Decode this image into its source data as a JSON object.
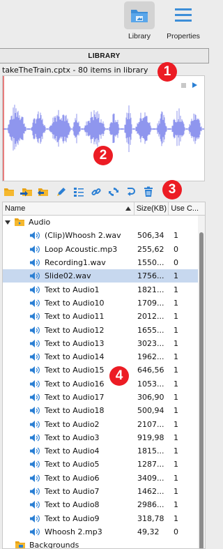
{
  "toolbar": {
    "library_label": "Library",
    "properties_label": "Properties"
  },
  "library": {
    "header": "LIBRARY",
    "info": "takeTheTrain.cptx - 80 items in library"
  },
  "preview": {
    "stop_icon": "stop-icon",
    "play_icon": "play-icon"
  },
  "icon_toolbar": [
    {
      "name": "new-folder-icon"
    },
    {
      "name": "import-icon"
    },
    {
      "name": "open-folder-icon"
    },
    {
      "name": "edit-icon"
    },
    {
      "name": "properties-list-icon"
    },
    {
      "name": "link-icon"
    },
    {
      "name": "update-icon"
    },
    {
      "name": "usage-icon"
    },
    {
      "name": "delete-icon"
    }
  ],
  "table": {
    "columns": [
      "Name",
      "Size(KB)",
      "Use C..."
    ],
    "rows": [
      {
        "type": "folder",
        "level": 0,
        "name": "Audio",
        "expanded": true
      },
      {
        "type": "audio",
        "level": 2,
        "name": "(Clip)Whoosh 2.wav",
        "size": "506,34",
        "use": "1"
      },
      {
        "type": "audio",
        "level": 2,
        "name": "Loop Acoustic.mp3",
        "size": "255,62",
        "use": "0"
      },
      {
        "type": "audio",
        "level": 2,
        "name": "Recording1.wav",
        "size": "1550...",
        "use": "0"
      },
      {
        "type": "audio",
        "level": 2,
        "name": "Slide02.wav",
        "size": "1756...",
        "use": "1",
        "selected": true
      },
      {
        "type": "audio",
        "level": 2,
        "name": "Text to Audio1",
        "size": "1821...",
        "use": "1"
      },
      {
        "type": "audio",
        "level": 2,
        "name": "Text to Audio10",
        "size": "1709...",
        "use": "1"
      },
      {
        "type": "audio",
        "level": 2,
        "name": "Text to Audio11",
        "size": "2012...",
        "use": "1"
      },
      {
        "type": "audio",
        "level": 2,
        "name": "Text to Audio12",
        "size": "1655...",
        "use": "1"
      },
      {
        "type": "audio",
        "level": 2,
        "name": "Text to Audio13",
        "size": "3023...",
        "use": "1"
      },
      {
        "type": "audio",
        "level": 2,
        "name": "Text to Audio14",
        "size": "1962...",
        "use": "1"
      },
      {
        "type": "audio",
        "level": 2,
        "name": "Text to Audio15",
        "size": "646,56",
        "use": "1"
      },
      {
        "type": "audio",
        "level": 2,
        "name": "Text to Audio16",
        "size": "1053...",
        "use": "1"
      },
      {
        "type": "audio",
        "level": 2,
        "name": "Text to Audio17",
        "size": "306,90",
        "use": "1"
      },
      {
        "type": "audio",
        "level": 2,
        "name": "Text to Audio18",
        "size": "500,94",
        "use": "1"
      },
      {
        "type": "audio",
        "level": 2,
        "name": "Text to Audio2",
        "size": "2107...",
        "use": "1"
      },
      {
        "type": "audio",
        "level": 2,
        "name": "Text to Audio3",
        "size": "919,98",
        "use": "1"
      },
      {
        "type": "audio",
        "level": 2,
        "name": "Text to Audio4",
        "size": "1815...",
        "use": "1"
      },
      {
        "type": "audio",
        "level": 2,
        "name": "Text to Audio5",
        "size": "1287...",
        "use": "1"
      },
      {
        "type": "audio",
        "level": 2,
        "name": "Text to Audio6",
        "size": "3409...",
        "use": "1"
      },
      {
        "type": "audio",
        "level": 2,
        "name": "Text to Audio7",
        "size": "1462...",
        "use": "1"
      },
      {
        "type": "audio",
        "level": 2,
        "name": "Text to Audio8",
        "size": "2986...",
        "use": "1"
      },
      {
        "type": "audio",
        "level": 2,
        "name": "Text to Audio9",
        "size": "318,78",
        "use": "1"
      },
      {
        "type": "audio",
        "level": 2,
        "name": "Whoosh 2.mp3",
        "size": "49,32",
        "use": "0"
      },
      {
        "type": "folder",
        "level": 1,
        "name": "Backgrounds",
        "expanded": false
      }
    ]
  },
  "callouts": [
    "1",
    "2",
    "3",
    "4"
  ],
  "colors": {
    "accent": "#2a7fd4",
    "waveform": "#8f96ee",
    "selection": "#c7d8ef",
    "callout": "#ec1c24",
    "playhead": "#e05050"
  }
}
